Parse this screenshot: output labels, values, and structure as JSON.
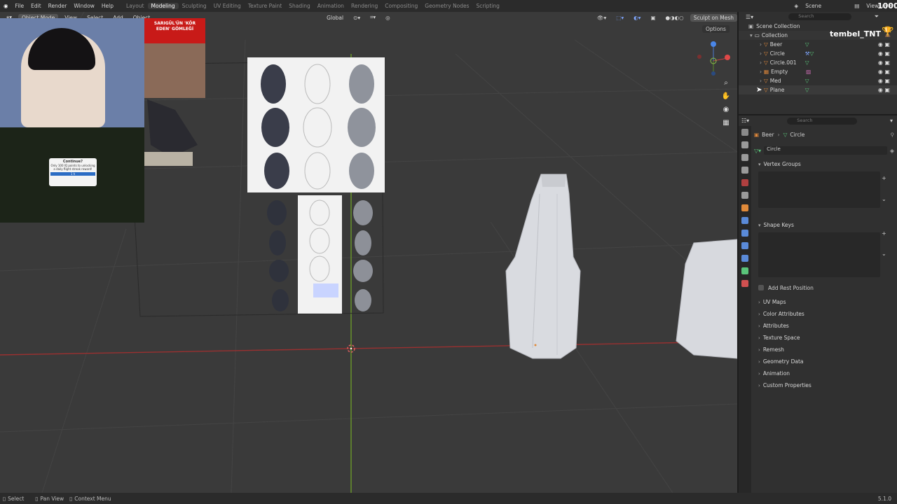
{
  "menu": {
    "items": [
      "File",
      "Edit",
      "Render",
      "Window",
      "Help"
    ],
    "workspaces": [
      "Layout",
      "Modeling",
      "Sculpting",
      "UV Editing",
      "Texture Paint",
      "Shading",
      "Animation",
      "Rendering",
      "Compositing",
      "Geometry Nodes",
      "Scripting"
    ],
    "active_workspace": "Modeling",
    "scene": "Scene",
    "view_layer": "ViewLayer"
  },
  "viewport_header": {
    "mode": "Object Mode",
    "view": "View",
    "select": "Select",
    "add": "Add",
    "object": "Object",
    "transform": "Global",
    "sculpt_button": "Sculpt on Mesh",
    "options": "Options"
  },
  "overlay": {
    "news_caption": "SARIGÜL'ÜN 'KÖR EDEN' GÖMLEĞİ",
    "streamer_name": "tembel_TNT",
    "score": "1000",
    "popup_title": "Continue?",
    "popup_text": "Only 100 IQ points to unlocking a daily flight streak reward!",
    "popup_button": "1 h"
  },
  "outliner": {
    "search_placeholder": "Search",
    "scene_collection": "Scene Collection",
    "collection": "Collection",
    "objects": [
      "Beer",
      "Circle",
      "Circle.001",
      "Empty",
      "Med",
      "Plane"
    ]
  },
  "properties": {
    "search_placeholder": "Search",
    "breadcrumb_object": "Beer",
    "breadcrumb_mesh": "Circle",
    "mesh_name": "Circle",
    "sections_open": [
      "Vertex Groups",
      "Shape Keys"
    ],
    "add_rest_position": "Add Rest Position",
    "sections_closed": [
      "UV Maps",
      "Color Attributes",
      "Attributes",
      "Texture Space",
      "Remesh",
      "Geometry Data",
      "Animation",
      "Custom Properties"
    ]
  },
  "statusbar": {
    "select": "Select",
    "pan_view": "Pan View",
    "context_menu": "Context Menu",
    "version": "5.1.0"
  }
}
